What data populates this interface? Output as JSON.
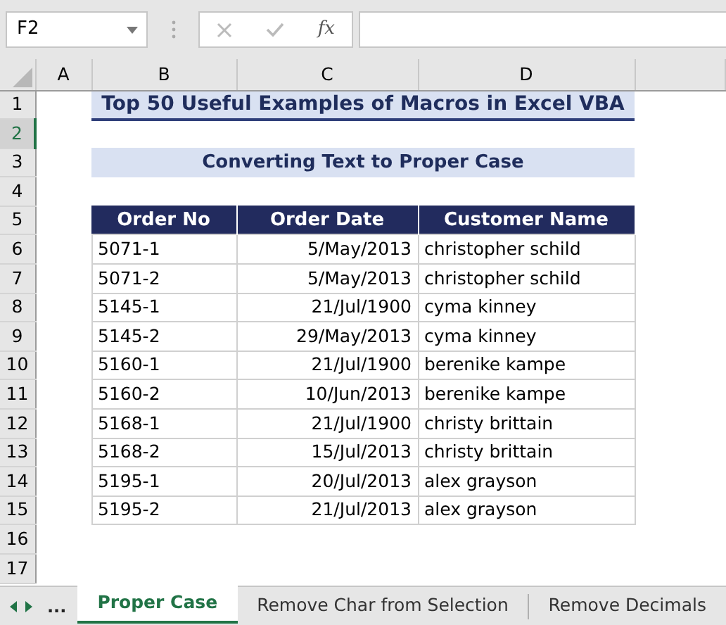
{
  "name_box": {
    "value": "F2"
  },
  "formula_bar": {
    "function_label": "fx"
  },
  "columns": [
    {
      "label": "A"
    },
    {
      "label": "B"
    },
    {
      "label": "C"
    },
    {
      "label": "D"
    }
  ],
  "rows": [
    {
      "number": "1",
      "selected": false
    },
    {
      "number": "2",
      "selected": true
    },
    {
      "number": "3",
      "selected": false
    },
    {
      "number": "4",
      "selected": false
    },
    {
      "number": "5",
      "selected": false
    },
    {
      "number": "6",
      "selected": false
    },
    {
      "number": "7",
      "selected": false
    },
    {
      "number": "8",
      "selected": false
    },
    {
      "number": "9",
      "selected": false
    },
    {
      "number": "10",
      "selected": false
    },
    {
      "number": "11",
      "selected": false
    },
    {
      "number": "12",
      "selected": false
    },
    {
      "number": "13",
      "selected": false
    },
    {
      "number": "14",
      "selected": false
    },
    {
      "number": "15",
      "selected": false
    },
    {
      "number": "16",
      "selected": false
    },
    {
      "number": "17",
      "selected": false
    }
  ],
  "title": "Top 50 Useful Examples of Macros in Excel VBA",
  "subtitle": "Converting Text to Proper Case",
  "table": {
    "columns": [
      "Order No",
      "Order Date",
      "Customer Name"
    ],
    "rows": [
      [
        "5071-1",
        "5/May/2013",
        "christopher schild"
      ],
      [
        "5071-2",
        "5/May/2013",
        "christopher schild"
      ],
      [
        "5145-1",
        "21/Jul/1900",
        "cyma kinney"
      ],
      [
        "5145-2",
        "29/May/2013",
        "cyma kinney"
      ],
      [
        "5160-1",
        "21/Jul/1900",
        "berenike kampe"
      ],
      [
        "5160-2",
        "10/Jun/2013",
        "berenike kampe"
      ],
      [
        "5168-1",
        "21/Jul/1900",
        "christy brittain"
      ],
      [
        "5168-2",
        "15/Jul/2013",
        "christy brittain"
      ],
      [
        "5195-1",
        "20/Jul/2013",
        "alex grayson"
      ],
      [
        "5195-2",
        "21/Jul/2013",
        "alex grayson"
      ]
    ]
  },
  "sheet_tabs": {
    "more": "...",
    "tabs": [
      {
        "label": "Proper Case",
        "selected": true
      },
      {
        "label": "Remove Char from Selection",
        "selected": false
      },
      {
        "label": "Remove Decimals",
        "selected": false
      }
    ]
  }
}
